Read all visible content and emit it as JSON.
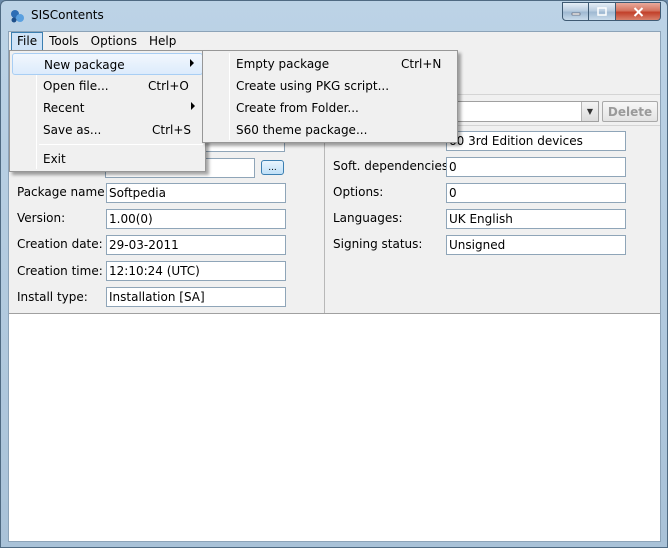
{
  "window": {
    "title": "SISContents"
  },
  "menubar": [
    {
      "label": "File"
    },
    {
      "label": "Tools"
    },
    {
      "label": "Options"
    },
    {
      "label": "Help"
    }
  ],
  "file_menu": {
    "items": [
      {
        "label": "New package",
        "shortcut": ""
      },
      {
        "label": "Open file...",
        "shortcut": "Ctrl+O"
      },
      {
        "label": "Recent",
        "shortcut": ""
      },
      {
        "label": "Save as...",
        "shortcut": "Ctrl+S"
      },
      {
        "label": "Exit",
        "shortcut": ""
      }
    ]
  },
  "new_package_submenu": {
    "items": [
      {
        "label": "Empty package",
        "shortcut": "Ctrl+N"
      },
      {
        "label": "Create using PKG script...",
        "shortcut": ""
      },
      {
        "label": "Create from Folder...",
        "shortcut": ""
      },
      {
        "label": "S60 theme package...",
        "shortcut": ""
      }
    ]
  },
  "toolbar": {
    "delete_label": "Delete",
    "browse_label": "..."
  },
  "left_fields": [
    {
      "label": "Package name:",
      "value": "Softpedia"
    },
    {
      "label": "Version:",
      "value": "1.00(0)"
    },
    {
      "label": "Creation date:",
      "value": "29-03-2011"
    },
    {
      "label": "Creation time:",
      "value": "12:10:24 (UTC)"
    },
    {
      "label": "Install type:",
      "value": "Installation [SA]"
    }
  ],
  "right_fields": [
    {
      "label": "",
      "value": "60 3rd Edition devices"
    },
    {
      "label": "Soft. dependencies:",
      "value": "0"
    },
    {
      "label": "Options:",
      "value": "0"
    },
    {
      "label": "Languages:",
      "value": "UK English"
    },
    {
      "label": "Signing status:",
      "value": "Unsigned"
    }
  ]
}
